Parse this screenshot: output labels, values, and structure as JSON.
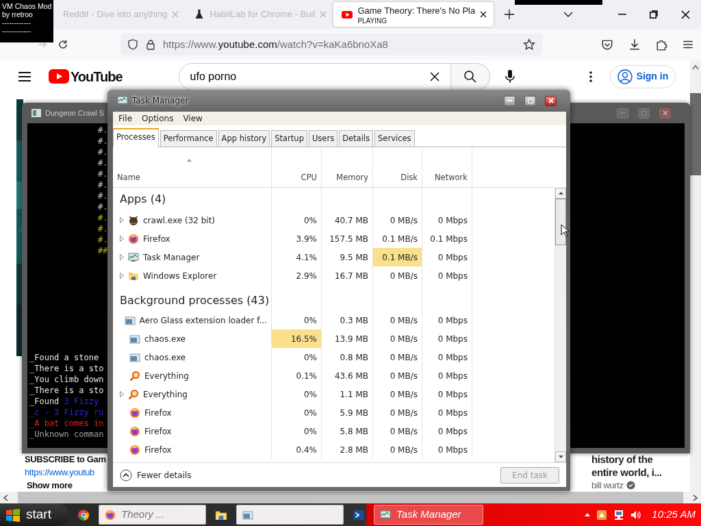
{
  "overlay": {
    "lines": [
      "VM Chaos Mod",
      "by rretroo",
      "------------",
      "------------"
    ]
  },
  "browser": {
    "tabs": [
      {
        "title": "Reddit - Dive into anything",
        "kind": "page",
        "selected": false
      },
      {
        "title": "HabitLab for Chrome - Buil",
        "kind": "flask",
        "selected": false
      },
      {
        "title": "Game Theory: There's No Pla",
        "subtitle": "PLAYING",
        "kind": "play",
        "selected": true
      }
    ],
    "url": {
      "scheme": "https://www.",
      "domain": "youtube.com",
      "path": "/watch?v=kaKa6bnoXa8"
    }
  },
  "youtube": {
    "logo": "YouTube",
    "search": {
      "value": "ufo porno"
    },
    "sign_in": "Sign in",
    "description": {
      "title": "SUBSCRIBE to Gam",
      "link": "https://www.youtub",
      "more": "Show more"
    },
    "recommendation": {
      "title_lines": [
        "history of the",
        "entire world, i..."
      ],
      "channel": "bill wurtz",
      "verified": true
    }
  },
  "dungeon": {
    "title": "Dungeon Crawl S",
    "map": [
      {
        "text": "#.",
        "kind": "wall"
      },
      {
        "text": "#.",
        "kind": "wall"
      },
      {
        "text": "#.",
        "kind": "wall"
      },
      {
        "text": "#.",
        "kind": "wall"
      },
      {
        "text": "#.",
        "kind": "wall"
      },
      {
        "text": "#.",
        "kind": "wall"
      },
      {
        "text": "#.",
        "kind": "wall"
      },
      {
        "text": "#.",
        "kind": "wall"
      },
      {
        "text": "#.",
        "kind": "lit"
      },
      {
        "text": "#.",
        "kind": "lit"
      },
      {
        "text": "#.",
        "kind": "lit"
      },
      {
        "text": "##",
        "kind": "lit"
      }
    ],
    "messages": [
      [
        {
          "text": "_Found a stone",
          "color": "#e8e8e8"
        }
      ],
      [
        {
          "text": "_There is a sto",
          "color": "#e8e8e8"
        }
      ],
      [
        {
          "text": "_You climb down",
          "color": "#e8e8e8"
        }
      ],
      [
        {
          "text": "_There is a sto",
          "color": "#e8e8e8"
        }
      ],
      [
        {
          "text": "_Found ",
          "color": "#e8e8e8"
        },
        {
          "text": "3 Fizzy",
          "color": "#2a2ad8"
        }
      ],
      [
        {
          "text": "_c - 3 Fizzy ru",
          "color": "#2a2ad8"
        }
      ],
      [
        {
          "text": "_A bat comes in",
          "color": "#e82020"
        }
      ],
      [
        {
          "text": "_Unknown comman",
          "color": "#a0a0a0"
        }
      ]
    ]
  },
  "task_manager": {
    "title": "Task Manager",
    "menu": [
      "File",
      "Options",
      "View"
    ],
    "tabs": [
      {
        "label": "Processes",
        "selected": true
      },
      {
        "label": "Performance",
        "selected": false
      },
      {
        "label": "App history",
        "selected": false
      },
      {
        "label": "Startup",
        "selected": false
      },
      {
        "label": "Users",
        "selected": false
      },
      {
        "label": "Details",
        "selected": false
      },
      {
        "label": "Services",
        "selected": false
      }
    ],
    "columns": [
      "Name",
      "CPU",
      "Memory",
      "Disk",
      "Network"
    ],
    "groups": [
      {
        "label": "Apps (4)",
        "rows": [
          {
            "name": "crawl.exe (32 bit)",
            "kind": "creature",
            "expandable": true,
            "cells": [
              {
                "value": "0%",
                "hot": false
              },
              {
                "value": "40.7 MB",
                "hot": false
              },
              {
                "value": "0 MB/s",
                "hot": false
              },
              {
                "value": "0 Mbps",
                "hot": false
              }
            ]
          },
          {
            "name": "Firefox",
            "kind": "firefox",
            "expandable": true,
            "cells": [
              {
                "value": "3.9%",
                "hot": false
              },
              {
                "value": "157.5 MB",
                "hot": false
              },
              {
                "value": "0.1 MB/s",
                "hot": false
              },
              {
                "value": "0.1 Mbps",
                "hot": false
              }
            ]
          },
          {
            "name": "Task Manager",
            "kind": "taskmgr",
            "expandable": true,
            "cells": [
              {
                "value": "4.1%",
                "hot": false
              },
              {
                "value": "9.5 MB",
                "hot": false
              },
              {
                "value": "0.1 MB/s",
                "hot": true
              },
              {
                "value": "0 Mbps",
                "hot": false
              }
            ]
          },
          {
            "name": "Windows Explorer",
            "kind": "folder",
            "expandable": true,
            "cells": [
              {
                "value": "2.9%",
                "hot": false
              },
              {
                "value": "16.7 MB",
                "hot": false
              },
              {
                "value": "0 MB/s",
                "hot": false
              },
              {
                "value": "0 Mbps",
                "hot": false
              }
            ]
          }
        ]
      },
      {
        "label": "Background processes (43)",
        "rows": [
          {
            "name": "Aero Glass extension loader f...",
            "kind": "window",
            "expandable": false,
            "cells": [
              {
                "value": "0%",
                "hot": false
              },
              {
                "value": "0.3 MB",
                "hot": false
              },
              {
                "value": "0 MB/s",
                "hot": false
              },
              {
                "value": "0 Mbps",
                "hot": false
              }
            ]
          },
          {
            "name": "chaos.exe",
            "kind": "window",
            "expandable": false,
            "cells": [
              {
                "value": "16.5%",
                "hot": true
              },
              {
                "value": "13.9 MB",
                "hot": false
              },
              {
                "value": "0 MB/s",
                "hot": false
              },
              {
                "value": "0 Mbps",
                "hot": false
              }
            ]
          },
          {
            "name": "chaos.exe",
            "kind": "window",
            "expandable": false,
            "cells": [
              {
                "value": "0%",
                "hot": false
              },
              {
                "value": "0.8 MB",
                "hot": false
              },
              {
                "value": "0 MB/s",
                "hot": false
              },
              {
                "value": "0 Mbps",
                "hot": false
              }
            ]
          },
          {
            "name": "Everything",
            "kind": "magnifier",
            "expandable": false,
            "cells": [
              {
                "value": "0.1%",
                "hot": false
              },
              {
                "value": "43.6 MB",
                "hot": false
              },
              {
                "value": "0 MB/s",
                "hot": false
              },
              {
                "value": "0 Mbps",
                "hot": false
              }
            ]
          },
          {
            "name": "Everything",
            "kind": "magnifier",
            "expandable": true,
            "cells": [
              {
                "value": "0%",
                "hot": false
              },
              {
                "value": "1.1 MB",
                "hot": false
              },
              {
                "value": "0 MB/s",
                "hot": false
              },
              {
                "value": "0 Mbps",
                "hot": false
              }
            ]
          },
          {
            "name": "Firefox",
            "kind": "firefox",
            "expandable": false,
            "cells": [
              {
                "value": "0%",
                "hot": false
              },
              {
                "value": "5.9 MB",
                "hot": false
              },
              {
                "value": "0 MB/s",
                "hot": false
              },
              {
                "value": "0 Mbps",
                "hot": false
              }
            ]
          },
          {
            "name": "Firefox",
            "kind": "firefox",
            "expandable": false,
            "cells": [
              {
                "value": "0%",
                "hot": false
              },
              {
                "value": "5.8 MB",
                "hot": false
              },
              {
                "value": "0 MB/s",
                "hot": false
              },
              {
                "value": "0 Mbps",
                "hot": false
              }
            ]
          },
          {
            "name": "Firefox",
            "kind": "firefox",
            "expandable": false,
            "cells": [
              {
                "value": "0.4%",
                "hot": false
              },
              {
                "value": "2.8 MB",
                "hot": false
              },
              {
                "value": "0 MB/s",
                "hot": false
              },
              {
                "value": "0 Mbps",
                "hot": false
              }
            ]
          }
        ]
      }
    ],
    "footer": {
      "toggle": "Fewer details",
      "end_task": {
        "label": "End task",
        "disabled": true
      }
    }
  },
  "taskbar": {
    "start": "start",
    "items": [
      {
        "kind": "pinned"
      },
      {
        "kind": "window",
        "label": "Theory ...",
        "selected": false
      },
      {
        "kind": "pinned"
      },
      {
        "kind": "window",
        "selected": false
      },
      {
        "kind": "pinned"
      },
      {
        "kind": "window",
        "label": "Task Manager",
        "selected": true
      }
    ],
    "clock": "10:25 AM"
  }
}
